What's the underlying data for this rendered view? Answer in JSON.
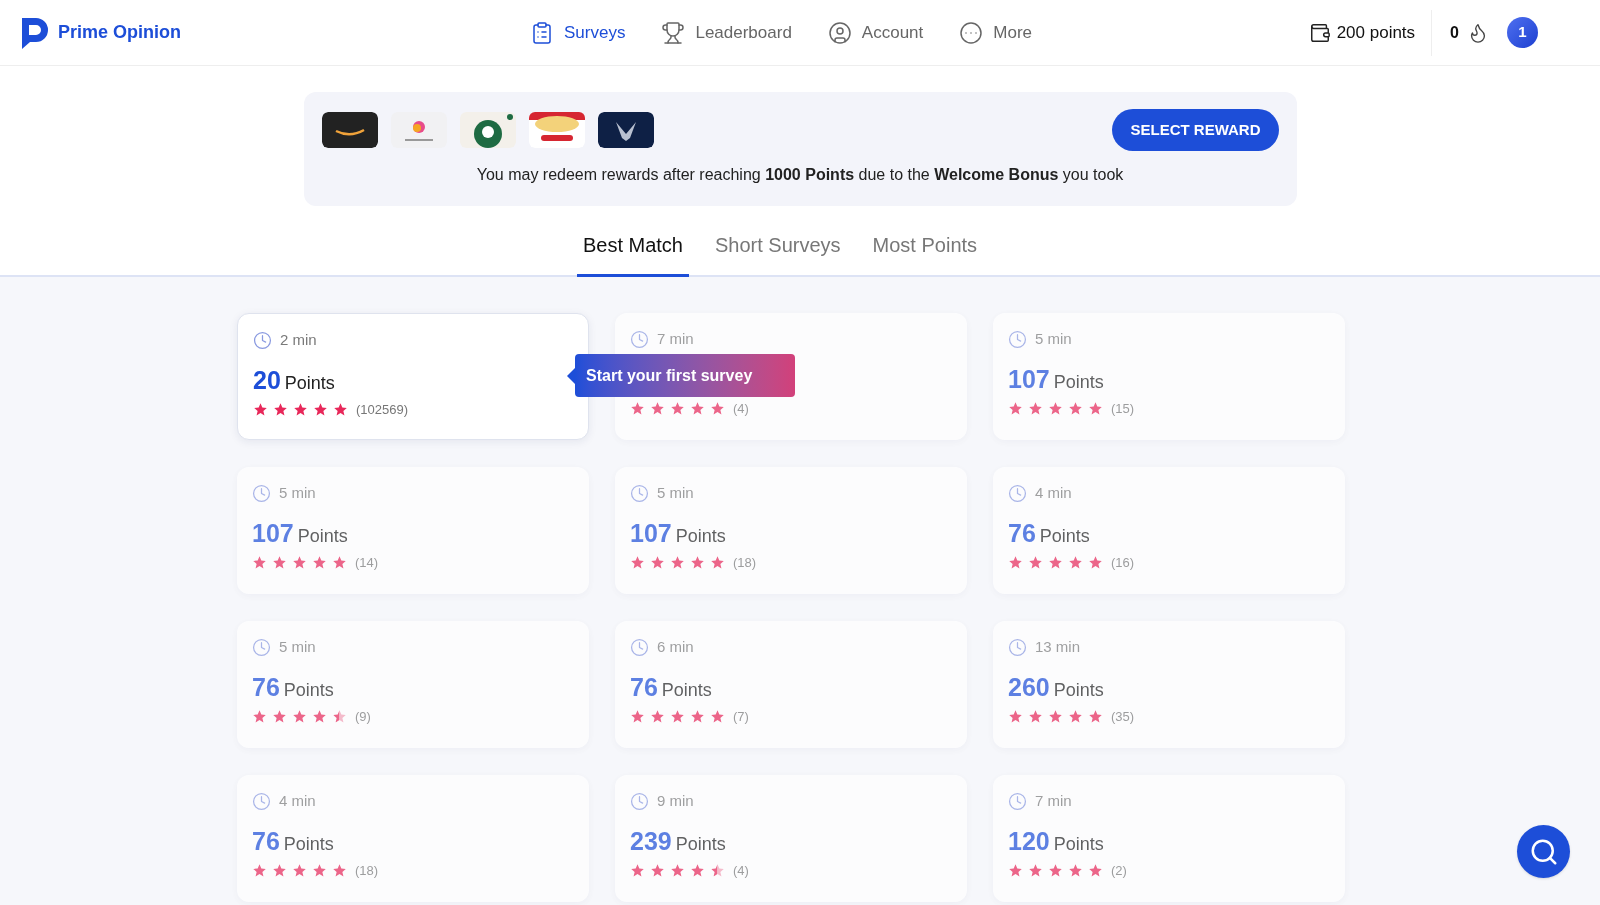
{
  "brand": {
    "name": "Prime Opinion"
  },
  "nav": [
    {
      "label": "Surveys",
      "kind": "clipboard",
      "selected": true
    },
    {
      "label": "Leaderboard",
      "kind": "trophy",
      "selected": false
    },
    {
      "label": "Account",
      "kind": "user",
      "selected": false
    },
    {
      "label": "More",
      "kind": "more",
      "selected": false
    }
  ],
  "balance": {
    "points": "200 points",
    "streak": "0",
    "avatar": "1"
  },
  "banner": {
    "rewards": [
      {
        "kind": "amazon"
      },
      {
        "kind": "apple"
      },
      {
        "kind": "starbucks"
      },
      {
        "kind": "amc"
      },
      {
        "kind": "eagle"
      }
    ],
    "button": "SELECT REWARD",
    "message": "You may redeem rewards after reaching **1000 Points** due to the **Welcome Bonus** you took"
  },
  "tabs": [
    {
      "label": "Best Match",
      "selected": true
    },
    {
      "label": "Short Surveys",
      "selected": false
    },
    {
      "label": "Most Points",
      "selected": false
    }
  ],
  "tooltip": "Start your first survey",
  "surveys": [
    {
      "time": "2 min",
      "points": "20",
      "unit": "Points",
      "stars": 5,
      "count": "(102569)",
      "blurred": false
    },
    {
      "time": "7 min",
      "stars": 5,
      "count": "(4)",
      "blurred": true
    },
    {
      "time": "5 min",
      "points": "107",
      "unit": "Points",
      "stars": 5,
      "count": "(15)",
      "blurred": true
    },
    {
      "time": "5 min",
      "points": "107",
      "unit": "Points",
      "stars": 5,
      "count": "(14)",
      "blurred": true
    },
    {
      "time": "5 min",
      "points": "107",
      "unit": "Points",
      "stars": 5,
      "count": "(18)",
      "blurred": true
    },
    {
      "time": "4 min",
      "points": "76",
      "unit": "Points",
      "stars": 5,
      "count": "(16)",
      "blurred": true
    },
    {
      "time": "5 min",
      "points": "76",
      "unit": "Points",
      "stars": 4.5,
      "count": "(9)",
      "blurred": true
    },
    {
      "time": "6 min",
      "points": "76",
      "unit": "Points",
      "stars": 5,
      "count": "(7)",
      "blurred": true
    },
    {
      "time": "13 min",
      "points": "260",
      "unit": "Points",
      "stars": 5,
      "count": "(35)",
      "blurred": true
    },
    {
      "time": "4 min",
      "points": "76",
      "unit": "Points",
      "stars": 5,
      "count": "(18)",
      "blurred": true
    },
    {
      "time": "9 min",
      "points": "239",
      "unit": "Points",
      "stars": 4.5,
      "count": "(4)",
      "blurred": true
    },
    {
      "time": "7 min",
      "points": "120",
      "unit": "Points",
      "stars": 5,
      "count": "(2)",
      "blurred": true
    }
  ]
}
